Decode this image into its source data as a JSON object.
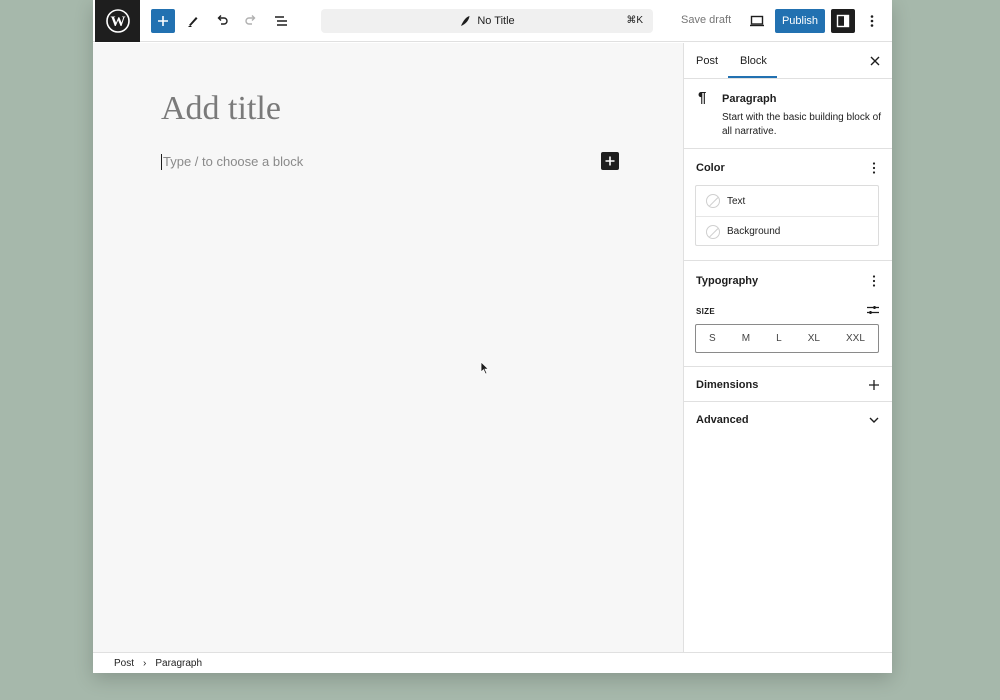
{
  "toolbar": {
    "document_title": "No Title",
    "shortcut": "⌘K",
    "save_draft_label": "Save draft",
    "publish_label": "Publish",
    "icons": [
      "wordpress-logo-icon",
      "plus-icon",
      "pen-icon",
      "undo-icon",
      "redo-icon",
      "list-view-icon",
      "feather-icon",
      "desktop-preview-icon",
      "sidebar-icon",
      "more-vertical-icon"
    ]
  },
  "canvas": {
    "title_placeholder": "Add title",
    "block_placeholder": "Type / to choose a block"
  },
  "sidebar": {
    "tabs": [
      {
        "label": "Post",
        "active": false
      },
      {
        "label": "Block",
        "active": true
      }
    ],
    "block_card": {
      "name": "Paragraph",
      "description": "Start with the basic building block of all narrative."
    },
    "color": {
      "title": "Color",
      "items": [
        "Text",
        "Background"
      ]
    },
    "typography": {
      "title": "Typography",
      "size_label": "SIZE",
      "sizes": [
        "S",
        "M",
        "L",
        "XL",
        "XXL"
      ]
    },
    "dimensions": {
      "title": "Dimensions"
    },
    "advanced": {
      "title": "Advanced"
    }
  },
  "footer": {
    "breadcrumb": [
      "Post",
      "Paragraph"
    ]
  },
  "colors": {
    "accent": "#2271b1",
    "dark": "#1e1e1e",
    "backdrop": "#a6b8ab"
  }
}
